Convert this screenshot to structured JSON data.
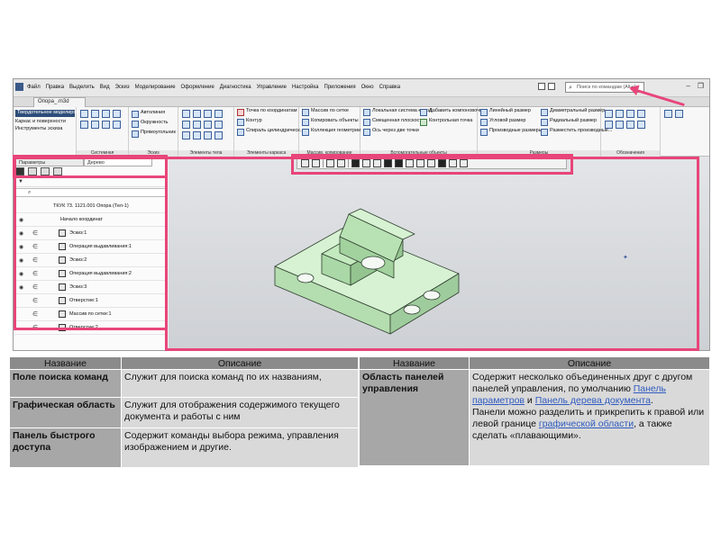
{
  "menu": {
    "items": [
      "Файл",
      "Правка",
      "Выделить",
      "Вид",
      "Эскиз",
      "Моделирование",
      "Оформление",
      "Диагностика",
      "Управление",
      "Настройка",
      "Приложения",
      "Окно",
      "Справка"
    ],
    "search_placeholder": "Поиск по командам (Alt+/)"
  },
  "document_tab": "Опора_.m3d",
  "ribbon": {
    "mode_items": [
      "Твердотельное моделирование",
      "Каркас и поверхности",
      "Инструменты эскиза"
    ],
    "sketch_items": [
      "Автолиния",
      "Окружность",
      "Прямоугольник"
    ],
    "frame_items": [
      "Точка по координатам",
      "Контур",
      "Спираль цилиндрическ..."
    ],
    "array_items": [
      "Массив по сетке",
      "Копировать объекты",
      "Коллекция геометрии"
    ],
    "aux_col1": [
      "Локальная система коорд...",
      "Смещенная плоскость",
      "Ось через две точки"
    ],
    "aux_col2": [
      "Добавить компоновочн...",
      "Контрольная точка"
    ],
    "dim_col1": [
      "Линейный размер",
      "Угловой размер",
      "Производные размеры"
    ],
    "dim_col2": [
      "Диаметральный размер",
      "Радиальный размер",
      "Разместить производные..."
    ],
    "group_labels": [
      "Системная",
      "Эскиз",
      "Элементы тела",
      "Элементы каркаса",
      "Массив, копирование",
      "Вспомогательные объекты",
      "Размеры",
      "Обозначения"
    ]
  },
  "panel": {
    "tabs": [
      "Параметры",
      "Дерево"
    ],
    "tree": [
      "ТКУК 73. 1121.001 Опора  (Тел-1)",
      "Начало координат",
      "Эскиз:1",
      "Операция выдавливания:1",
      "Эскиз:2",
      "Операция выдавливания:2",
      "Эскиз:3",
      "Отверстие:1",
      "Массив по сетке:1",
      "Отверстие:2"
    ]
  },
  "table_headers": {
    "name": "Название",
    "desc": "Описание"
  },
  "table_left": [
    {
      "name": "Поле поиска команд",
      "desc": "Служит для поиска команд по их названиям,"
    },
    {
      "name": "Графическая область",
      "desc": "Служит для отображения содержимого текущего документа и работы с ним"
    },
    {
      "name": "Панель быстрого доступа",
      "desc": "Содержит команды выбора режима, управления изображением и другие."
    }
  ],
  "table_right": {
    "name": "Область панелей управления",
    "text1": "Содержит несколько объединенных друг с другом панелей управления, по умолчанию",
    "link1": "Панель параметров",
    "and": "и",
    "link2": "Панель дерева документа",
    "text2": "Панели можно разделить и прикрепить к правой или левой границе",
    "link3": "графической области",
    "text3": ", а также сделать «плавающими»."
  },
  "colors": {
    "highlight": "#e8457a",
    "header_bg": "#8b8b8b",
    "name_bg": "#a7a7a7",
    "desc_bg": "#d9d9d9",
    "link": "#2f5bc0",
    "model": "#c8eec8"
  }
}
